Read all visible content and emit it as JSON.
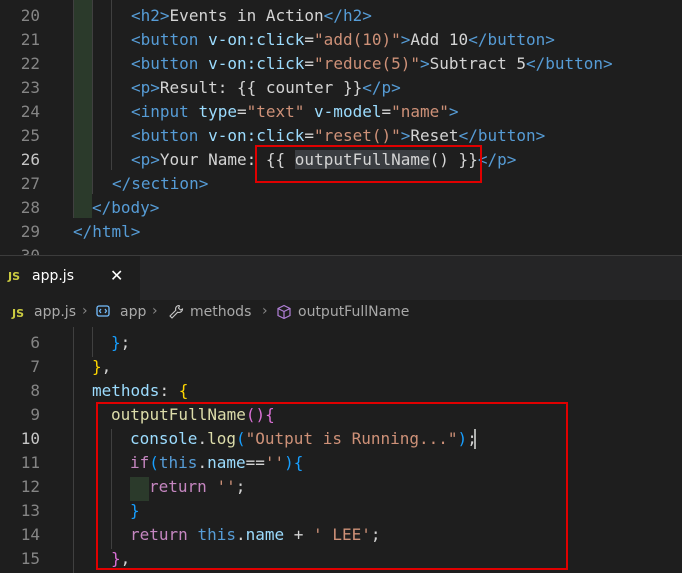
{
  "top_editor": {
    "lines": [
      {
        "num": "20",
        "parts": [
          [
            "tag",
            "<"
          ],
          [
            "tag",
            "h2"
          ],
          [
            "tag",
            ">"
          ],
          [
            "txt",
            "Events in Action"
          ],
          [
            "tag",
            "</"
          ],
          [
            "tag",
            "h2"
          ],
          [
            "tag",
            ">"
          ]
        ]
      },
      {
        "num": "21",
        "parts": [
          [
            "tag",
            "<"
          ],
          [
            "tag",
            "button "
          ],
          [
            "attr",
            "v-on:click"
          ],
          [
            "txt",
            "="
          ],
          [
            "str",
            "\"add(10)\""
          ],
          [
            "tag",
            ">"
          ],
          [
            "txt",
            "Add 10"
          ],
          [
            "tag",
            "</"
          ],
          [
            "tag",
            "button"
          ],
          [
            "tag",
            ">"
          ]
        ]
      },
      {
        "num": "22",
        "parts": [
          [
            "tag",
            "<"
          ],
          [
            "tag",
            "button "
          ],
          [
            "attr",
            "v-on:click"
          ],
          [
            "txt",
            "="
          ],
          [
            "str",
            "\"reduce(5)\""
          ],
          [
            "tag",
            ">"
          ],
          [
            "txt",
            "Subtract 5"
          ],
          [
            "tag",
            "</"
          ],
          [
            "tag",
            "button"
          ],
          [
            "tag",
            ">"
          ]
        ]
      },
      {
        "num": "23",
        "parts": [
          [
            "tag",
            "<"
          ],
          [
            "tag",
            "p"
          ],
          [
            "tag",
            ">"
          ],
          [
            "txt",
            "Result: {{ counter }}"
          ],
          [
            "tag",
            "</"
          ],
          [
            "tag",
            "p"
          ],
          [
            "tag",
            ">"
          ]
        ]
      },
      {
        "num": "24",
        "parts": [
          [
            "tag",
            "<"
          ],
          [
            "tag",
            "input "
          ],
          [
            "attr",
            "type"
          ],
          [
            "txt",
            "="
          ],
          [
            "str",
            "\"text\""
          ],
          [
            "attr",
            " v-model"
          ],
          [
            "txt",
            "="
          ],
          [
            "str",
            "\"name\""
          ],
          [
            "tag",
            ">"
          ]
        ]
      },
      {
        "num": "25",
        "parts": [
          [
            "tag",
            "<"
          ],
          [
            "tag",
            "button "
          ],
          [
            "attr",
            "v-on:click"
          ],
          [
            "txt",
            "="
          ],
          [
            "str",
            "\"reset()\""
          ],
          [
            "tag",
            ">"
          ],
          [
            "txt",
            "Reset"
          ],
          [
            "tag",
            "</"
          ],
          [
            "tag",
            "button"
          ],
          [
            "tag",
            ">"
          ]
        ]
      },
      {
        "num": "26",
        "parts": [
          [
            "tag",
            "<"
          ],
          [
            "tag",
            "p"
          ],
          [
            "tag",
            ">"
          ],
          [
            "txt",
            "Your Name: "
          ],
          [
            "txt",
            "{{ "
          ],
          [
            "sel",
            "outputFullName"
          ],
          [
            "txt",
            "() }}"
          ],
          [
            "tag",
            "</"
          ],
          [
            "tag",
            "p"
          ],
          [
            "tag",
            ">"
          ]
        ]
      },
      {
        "num": "27",
        "parts": [
          [
            "tag",
            "</"
          ],
          [
            "tag",
            "section"
          ],
          [
            "tag",
            ">"
          ]
        ]
      },
      {
        "num": "28",
        "parts": [
          [
            "tag",
            "</"
          ],
          [
            "tag",
            "body"
          ],
          [
            "tag",
            ">"
          ]
        ]
      },
      {
        "num": "29",
        "parts": [
          [
            "tag",
            "</"
          ],
          [
            "tag",
            "html"
          ],
          [
            "tag",
            ">"
          ]
        ]
      },
      {
        "num": "30",
        "parts": []
      }
    ]
  },
  "tab": {
    "badge": "JS",
    "label": "app.js",
    "close": "✕"
  },
  "breadcrumb": {
    "badge": "JS",
    "file": "app.js",
    "app": "app",
    "methods": "methods",
    "method": "outputFullName"
  },
  "bottom_editor": {
    "lines": [
      {
        "num": "6",
        "parts": [
          [
            "paren-b",
            "}"
          ],
          [
            "txt",
            ";"
          ]
        ]
      },
      {
        "num": "7",
        "parts": [
          [
            "paren-y",
            "}"
          ],
          [
            "txt",
            ","
          ]
        ]
      },
      {
        "num": "8",
        "parts": [
          [
            "attr",
            "methods"
          ],
          [
            "txt",
            ": "
          ],
          [
            "paren-y",
            "{"
          ]
        ]
      },
      {
        "num": "9",
        "parts": [
          [
            "fn",
            "outputFullName"
          ],
          [
            "paren-p",
            "()"
          ],
          [
            "paren-p",
            "{"
          ]
        ]
      },
      {
        "num": "10",
        "parts": [
          [
            "attr",
            "console"
          ],
          [
            "txt",
            "."
          ],
          [
            "fn",
            "log"
          ],
          [
            "paren-b",
            "("
          ],
          [
            "str",
            "\"Output is Running...\""
          ],
          [
            "paren-b",
            ")"
          ],
          [
            "txt",
            ";"
          ]
        ]
      },
      {
        "num": "11",
        "parts": [
          [
            "kw",
            "if"
          ],
          [
            "paren-b",
            "("
          ],
          [
            "this",
            "this"
          ],
          [
            "txt",
            "."
          ],
          [
            "attr",
            "name"
          ],
          [
            "txt",
            "=="
          ],
          [
            "str",
            "''"
          ],
          [
            "paren-b",
            ")"
          ],
          [
            "paren-b",
            "{"
          ]
        ]
      },
      {
        "num": "12",
        "parts": [
          [
            "kw",
            "return "
          ],
          [
            "str",
            "''"
          ],
          [
            "txt",
            ";"
          ]
        ]
      },
      {
        "num": "13",
        "parts": [
          [
            "paren-b",
            "}"
          ]
        ]
      },
      {
        "num": "14",
        "parts": [
          [
            "kw",
            "return "
          ],
          [
            "this",
            "this"
          ],
          [
            "txt",
            "."
          ],
          [
            "attr",
            "name"
          ],
          [
            "txt",
            " + "
          ],
          [
            "str",
            "' LEE'"
          ],
          [
            "txt",
            ";"
          ]
        ]
      },
      {
        "num": "15",
        "parts": [
          [
            "paren-p",
            "}"
          ],
          [
            "txt",
            ","
          ]
        ]
      }
    ]
  }
}
